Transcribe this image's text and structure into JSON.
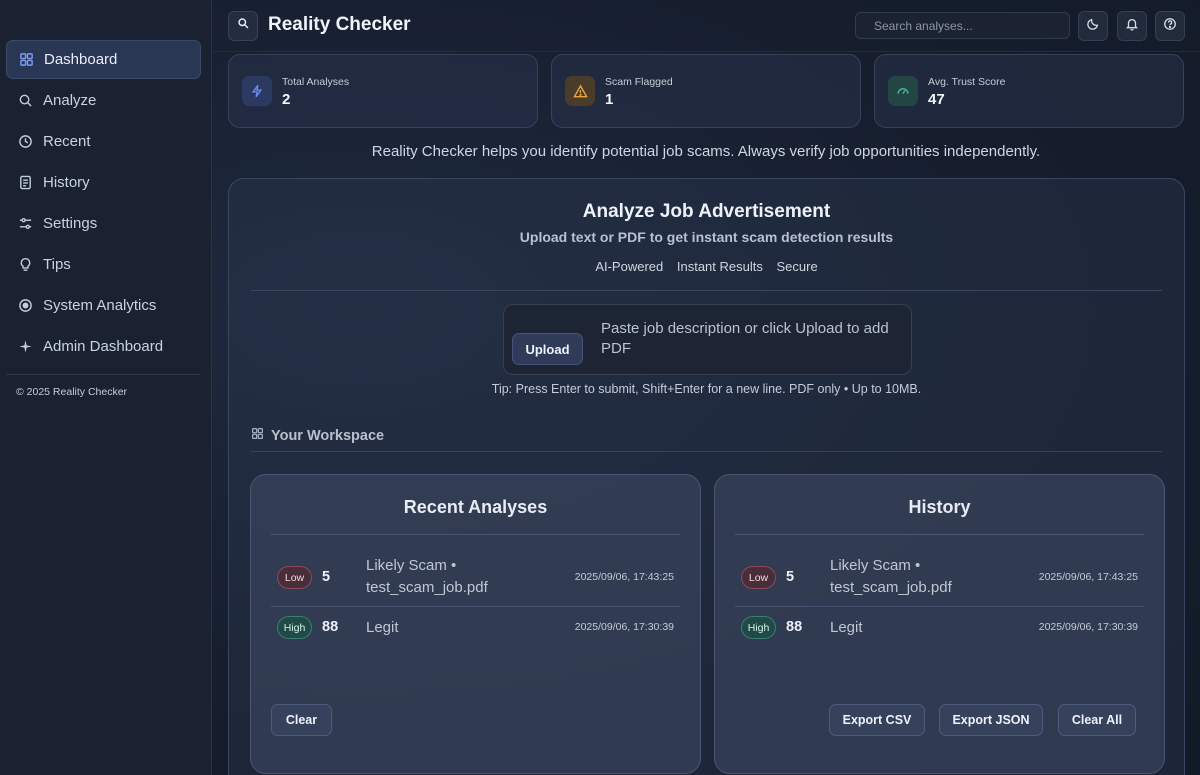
{
  "app": {
    "title": "Reality Checker"
  },
  "sidebar": {
    "items": [
      {
        "label": "Dashboard",
        "icon": "grid-icon",
        "active": true
      },
      {
        "label": "Analyze",
        "icon": "search-icon"
      },
      {
        "label": "Recent",
        "icon": "clock-icon"
      },
      {
        "label": "History",
        "icon": "document-icon"
      },
      {
        "label": "Settings",
        "icon": "sliders-icon"
      },
      {
        "label": "Tips",
        "icon": "lightbulb-icon"
      },
      {
        "label": "System Analytics",
        "icon": "target-icon"
      },
      {
        "label": "Admin Dashboard",
        "icon": "sparkle-icon"
      }
    ],
    "copyright": "© 2025 Reality Checker"
  },
  "header": {
    "search_placeholder": "Search analyses..."
  },
  "stats": [
    {
      "label": "Total Analyses",
      "value": "2",
      "icon": "bolt-icon",
      "color": "#4f6fd6"
    },
    {
      "label": "Scam Flagged",
      "value": "1",
      "icon": "warning-icon",
      "color": "#e0a23a"
    },
    {
      "label": "Avg. Trust Score",
      "value": "47",
      "icon": "gauge-icon",
      "color": "#3fb596"
    }
  ],
  "tagline": "Reality Checker helps you identify potential job scams. Always verify job opportunities independently.",
  "analyze": {
    "title": "Analyze Job Advertisement",
    "subtitle": "Upload text or PDF to get instant scam detection results",
    "features": [
      "AI-Powered",
      "Instant Results",
      "Secure"
    ],
    "upload_label": "Upload",
    "input_placeholder": "Paste job description or click Upload to add PDF",
    "tip": "Tip: Press Enter to submit, Shift+Enter for a new line. PDF only • Up to 10MB."
  },
  "workspace": {
    "title": "Your Workspace",
    "recent": {
      "title": "Recent Analyses",
      "rows": [
        {
          "badge": "Low",
          "score": "5",
          "verdict": "Likely Scam • test_scam_job.pdf",
          "timestamp": "2025/09/06, 17:43:25"
        },
        {
          "badge": "High",
          "score": "88",
          "verdict": "Legit",
          "timestamp": "2025/09/06, 17:30:39"
        }
      ],
      "clear_label": "Clear"
    },
    "history": {
      "title": "History",
      "rows": [
        {
          "badge": "Low",
          "score": "5",
          "verdict": "Likely Scam • test_scam_job.pdf",
          "timestamp": "2025/09/06, 17:43:25"
        },
        {
          "badge": "High",
          "score": "88",
          "verdict": "Legit",
          "timestamp": "2025/09/06, 17:30:39"
        }
      ],
      "export_csv_label": "Export CSV",
      "export_json_label": "Export JSON",
      "clear_all_label": "Clear All"
    }
  }
}
